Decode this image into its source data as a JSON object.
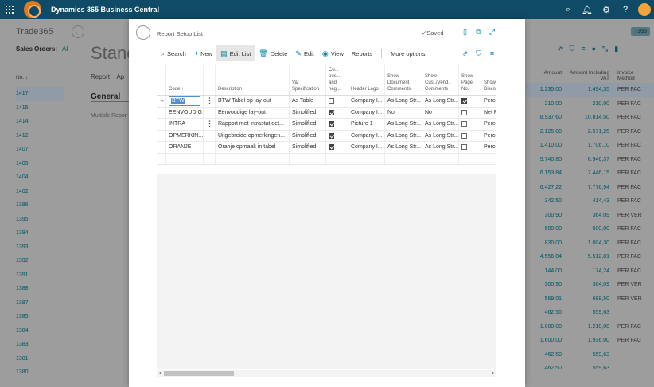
{
  "app": {
    "title": "Dynamics 365 Business Central",
    "icons": [
      "waffle-icon",
      "search-icon",
      "bell-icon",
      "gear-icon",
      "help-icon",
      "avatar"
    ]
  },
  "background": {
    "company": "Trade365",
    "sales_orders_label": "Sales Orders:",
    "sales_orders_filter": "Al",
    "page_title_partial": "Stanc",
    "tabs": [
      "Report",
      "Ap"
    ],
    "section": "General",
    "multiple_label": "Multiple Repor",
    "badge": "T365",
    "no_header": "No. ↓",
    "amount_header": "Amount",
    "amount_incl_header": "Amount Including VAT",
    "invoice_method_header": "Invoice Method",
    "rows": [
      {
        "no": "1417",
        "amount": "1.235,00",
        "amount_incl": "1.494,35",
        "method": "PER FAC"
      },
      {
        "no": "1415",
        "amount": "210,00",
        "amount_incl": "210,00",
        "method": "PER FAC"
      },
      {
        "no": "1414",
        "amount": "8.937,60",
        "amount_incl": "10.814,50",
        "method": "PER FAC"
      },
      {
        "no": "1412",
        "amount": "2.125,00",
        "amount_incl": "2.571,25",
        "method": "PER FAC"
      },
      {
        "no": "1407",
        "amount": "1.410,00",
        "amount_incl": "1.706,10",
        "method": "PER FAC"
      },
      {
        "no": "1405",
        "amount": "5.740,80",
        "amount_incl": "6.946,37",
        "method": "PER FAC"
      },
      {
        "no": "1404",
        "amount": "6.153,84",
        "amount_incl": "7.446,15",
        "method": "PER FAC"
      },
      {
        "no": "1402",
        "amount": "6.427,22",
        "amount_incl": "7.776,94",
        "method": "PER FAC"
      },
      {
        "no": "1396",
        "amount": "342,50",
        "amount_incl": "414,43",
        "method": "PER FAC"
      },
      {
        "no": "1395",
        "amount": "300,90",
        "amount_incl": "364,09",
        "method": "PER VER"
      },
      {
        "no": "1394",
        "amount": "500,00",
        "amount_incl": "500,00",
        "method": "PER FAC"
      },
      {
        "no": "1393",
        "amount": "830,00",
        "amount_incl": "1.004,30",
        "method": "PER FAC"
      },
      {
        "no": "1392",
        "amount": "4.556,04",
        "amount_incl": "5.512,81",
        "method": "PER FAC"
      },
      {
        "no": "1391",
        "amount": "144,00",
        "amount_incl": "174,24",
        "method": "PER FAC"
      },
      {
        "no": "1388",
        "amount": "300,90",
        "amount_incl": "364,09",
        "method": "PER VER"
      },
      {
        "no": "1387",
        "amount": "569,01",
        "amount_incl": "688,50",
        "method": "PER VER"
      },
      {
        "no": "1385",
        "amount": "462,50",
        "amount_incl": "559,63",
        "method": ""
      },
      {
        "no": "1384",
        "amount": "1.000,00",
        "amount_incl": "1.210,00",
        "method": "PER FAC"
      },
      {
        "no": "1383",
        "amount": "1.600,00",
        "amount_incl": "1.936,00",
        "method": "PER FAC"
      },
      {
        "no": "1381",
        "amount": "462,50",
        "amount_incl": "559,63",
        "method": ""
      },
      {
        "no": "1380",
        "amount": "462,50",
        "amount_incl": "559,63",
        "method": ""
      }
    ]
  },
  "dialog": {
    "title": "Report Setup List",
    "saved": "Saved",
    "actions": {
      "search": "Search",
      "new": "New",
      "edit_list": "Edit List",
      "delete": "Delete",
      "edit": "Edit",
      "view": "View",
      "reports": "Reports",
      "more": "More options"
    },
    "columns": {
      "code": "Code ↑",
      "description": "Description",
      "vat": "Vat Specification",
      "co": "Co... posi... and neg...",
      "header_logo": "Header Logo",
      "show_doc_comments": "Show Document Comments",
      "show_cust_comments": "Show Cust./Vend. Comments",
      "show_page_no": "Show Page No.",
      "show_discount": "Show Discou"
    },
    "rows": [
      {
        "code": "BTW",
        "description": "BTW Tabel op lay-out",
        "vat": "As Table",
        "co": false,
        "header_logo": "Company I...",
        "doc_comments": "As Long Str...",
        "cust_comments": "As Long Str...",
        "page_no": true,
        "discount": "Perce"
      },
      {
        "code": "EENVOUDIG",
        "description": "Eenvoudige lay-out",
        "vat": "Simplified",
        "co": true,
        "header_logo": "Company I...",
        "doc_comments": "No",
        "cust_comments": "No",
        "page_no": false,
        "discount": "Net P"
      },
      {
        "code": "INTRA",
        "description": "Rapport met intrastat det...",
        "vat": "Simplified",
        "co": true,
        "header_logo": "Picture 1",
        "doc_comments": "As Long Str...",
        "cust_comments": "As Long Str...",
        "page_no": false,
        "discount": "Perce"
      },
      {
        "code": "OPMERKIN...",
        "description": "Uitgebreide opmerkingen...",
        "vat": "Simplified",
        "co": true,
        "header_logo": "Company I...",
        "doc_comments": "As Long Str...",
        "cust_comments": "As Long Str...",
        "page_no": false,
        "discount": "Perce"
      },
      {
        "code": "ORANJE",
        "description": "Oranje opmaak in tabel",
        "vat": "Simplified",
        "co": true,
        "header_logo": "Company I...",
        "doc_comments": "As Long Str...",
        "cust_comments": "As Long Str...",
        "page_no": false,
        "discount": "Perce"
      }
    ]
  }
}
